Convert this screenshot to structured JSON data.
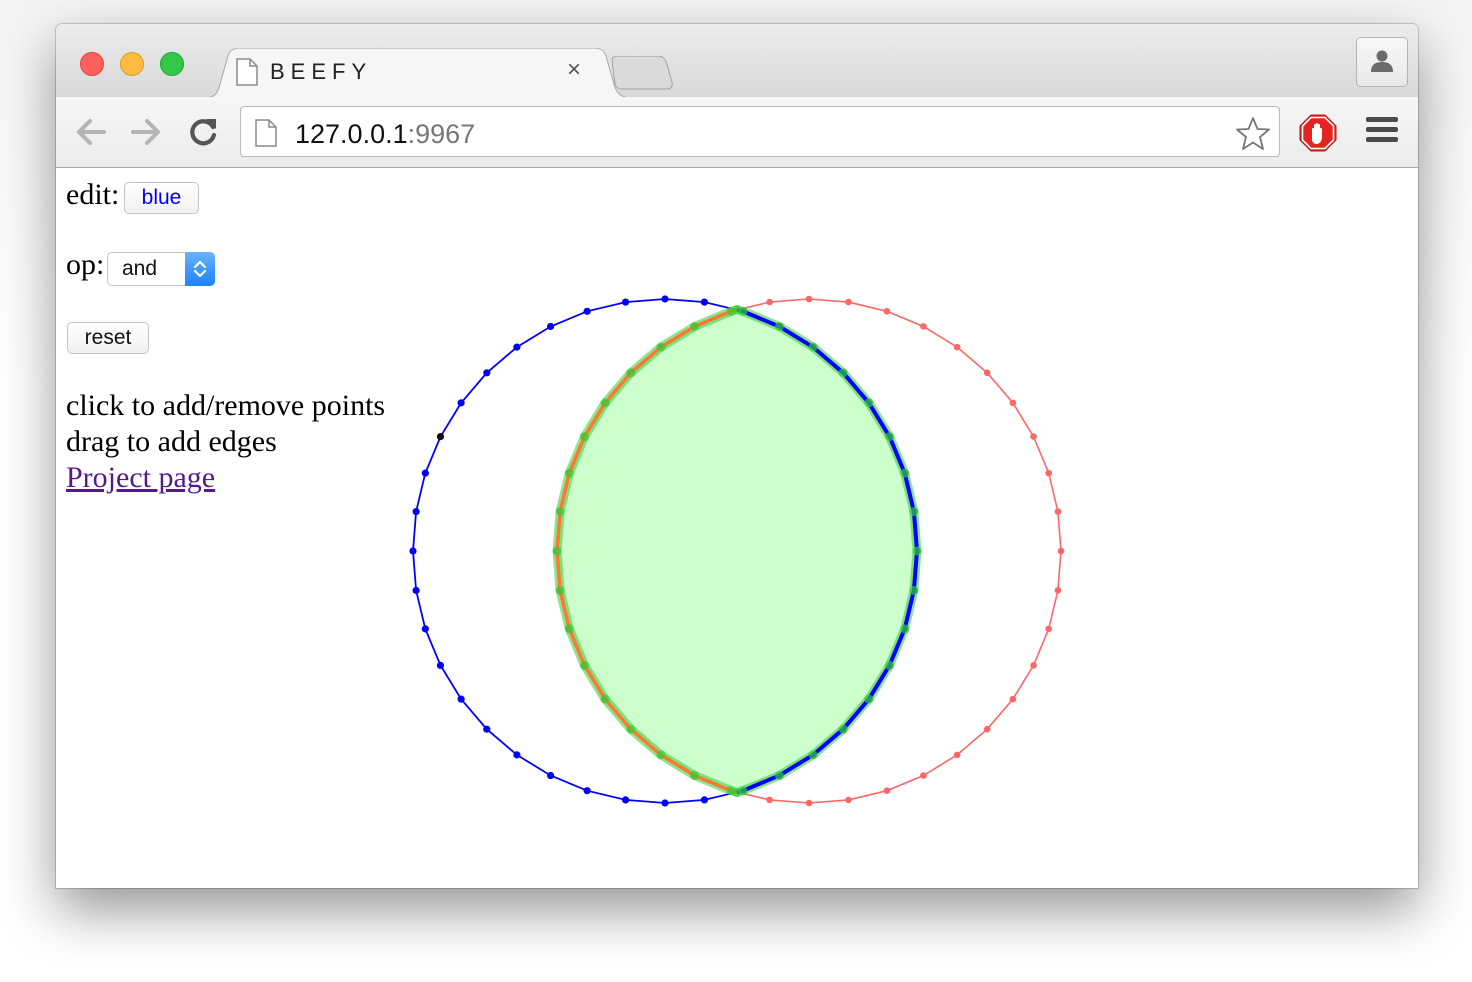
{
  "browser": {
    "tab_title": "BEEFY",
    "tab_close_glyph": "×",
    "url_host": "127.0.0.1",
    "url_port": ":9967",
    "icons": {
      "window_controls": [
        "close-light",
        "minimize-light",
        "maximize-light"
      ],
      "tab": "page-icon",
      "profile": "person-icon",
      "back": "back-arrow-icon",
      "forward": "forward-arrow-icon",
      "reload": "reload-icon",
      "bookmark": "star-icon",
      "extension": "stop-hand-icon",
      "menu": "hamburger-menu-icon"
    }
  },
  "page": {
    "edit_label": "edit:",
    "edit_value": "blue",
    "op_label": "op:",
    "op_value": "and",
    "reset_label": "reset",
    "help_click": "click to add/remove points",
    "help_drag": "drag to add edges",
    "project_link": "Project page"
  },
  "colors": {
    "blue_polygon": "#0000ff",
    "red_polygon": "#ff6666",
    "result_fill": "#ccffcc",
    "result_outline": "#33cc33",
    "result_edge_orange": "#ff7733",
    "link_visited": "#551a8b",
    "edit_button_text": "#0000ee"
  },
  "scene": {
    "blue_circle": {
      "vertex_count": 40,
      "color": "#0000ff"
    },
    "red_circle": {
      "vertex_count": 40,
      "color": "#ff6666"
    },
    "operation_result": {
      "op": "and",
      "fill": "#ccffcc"
    }
  }
}
